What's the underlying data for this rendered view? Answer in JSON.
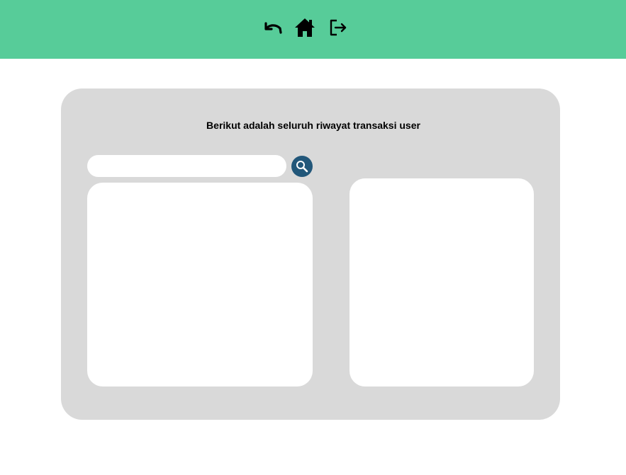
{
  "header": {
    "background_color": "#57cc99",
    "icons": {
      "back": "undo-arrow-icon",
      "home": "home-icon",
      "logout": "logout-icon"
    }
  },
  "panel": {
    "title": "Berikut adalah seluruh riwayat transaksi user",
    "background_color": "#d9d9d9"
  },
  "search": {
    "value": "",
    "placeholder": "",
    "button_icon": "search-icon",
    "button_color": "#22577a"
  },
  "transaction_list": {
    "items": []
  },
  "transaction_detail": {
    "content": ""
  }
}
